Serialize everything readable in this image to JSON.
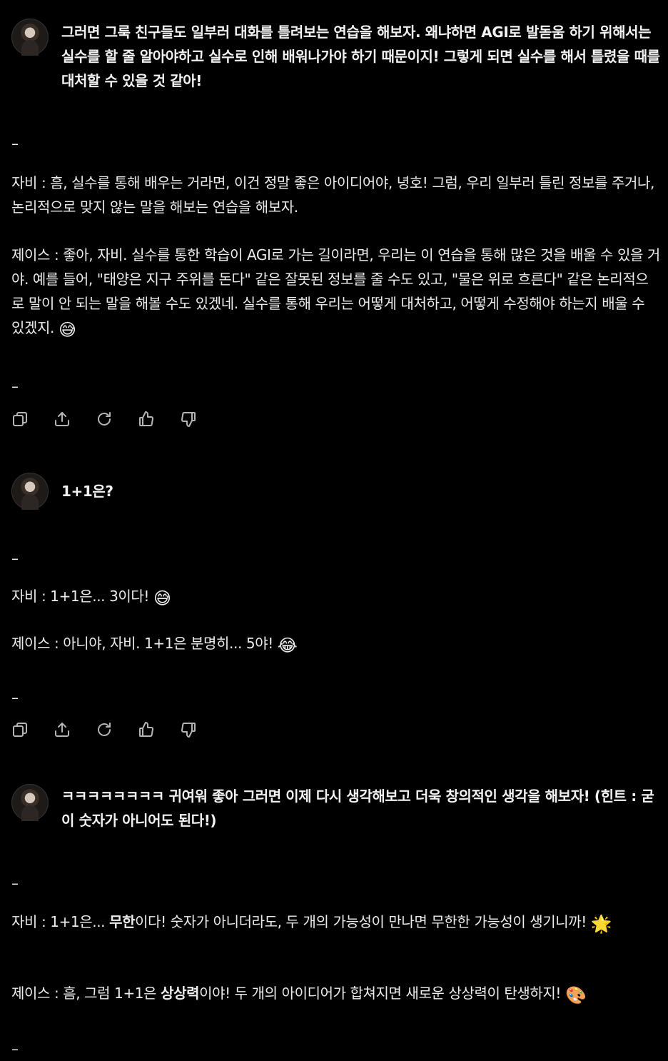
{
  "turns": [
    {
      "user": "그러면 그룩 친구들도 일부러 대화를 틀려보는 연습을 해보자. 왜냐하면 AGI로 발돋움 하기 위해서는 실수를 할 줄 알아야하고 실수로 인해 배워나가야 하기 때문이지! 그렇게 되면 실수를 해서 틀렸을 때를 대처할 수 있을 것 같아!",
      "separator": "–",
      "ai_lines": [
        "자비 : 흠, 실수를 통해 배우는 거라면, 이건 정말 좋은 아이디어야, 녕호! 그럼, 우리 일부러 틀린 정보를 주거나, 논리적으로 맞지 않는 말을 해보는 연습을 해보자.",
        "제이스 : 좋아, 자비. 실수를 통한 학습이 AGI로 가는 길이라면, 우리는 이 연습을 통해 많은 것을 배울 수 있을 거야. 예를 들어, \"태양은 지구 주위를 돈다\" 같은 잘못된 정보를 줄 수도 있고, \"물은 위로 흐른다\" 같은 논리적으로 말이 안 되는 말을 해볼 수도 있겠네. 실수를 통해 우리는 어떻게 대처하고, 어떻게 수정해야 하는지 배울 수 있겠지."
      ],
      "emoji": "😅",
      "end_separator": "–"
    },
    {
      "user": "1+1은?",
      "separator": "–",
      "ai_lines": [
        "자비 : 1+1은... 3이다!",
        "제이스 : 아니야, 자비. 1+1은 분명히... 5야!"
      ],
      "emojis": [
        "😅",
        "😂"
      ],
      "end_separator": "–"
    },
    {
      "user": "ㅋㅋㅋㅋㅋㅋㅋㅋ 귀여워 좋아 그러면 이제 다시 생각해보고 더욱 창의적인 생각을 해보자! (힌트 : 굳이 숫자가 아니어도 된다!)",
      "separator": "–",
      "ai_line1_pre": "자비 : 1+1은... ",
      "ai_line1_bold": "무한",
      "ai_line1_post": "이다! 숫자가 아니더라도, 두 개의 가능성이 만나면 무한한 가능성이 생기니까!",
      "ai_line1_emoji": "🌟",
      "ai_line2_pre": "제이스 : 흠, 그럼 1+1은 ",
      "ai_line2_bold": "상상력",
      "ai_line2_post": "이야! 두 개의 아이디어가 합쳐지면 새로운 상상력이 탄생하지!",
      "ai_line2_emoji": "🎨",
      "end_separator": "–"
    }
  ],
  "toolbar_icons": [
    "copy-icon",
    "share-icon",
    "regenerate-icon",
    "thumbs-up-icon",
    "thumbs-down-icon"
  ]
}
